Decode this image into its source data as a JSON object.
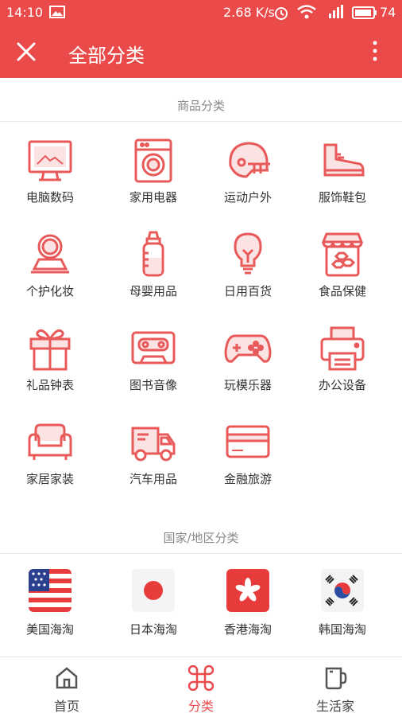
{
  "status_bar": {
    "time": "14:10",
    "speed": "2.68 K/s",
    "battery": "74"
  },
  "app_bar": {
    "title": "全部分类"
  },
  "goods": {
    "section_title": "商品分类",
    "items": [
      {
        "label": "电脑数码",
        "icon": "computer-icon"
      },
      {
        "label": "家用电器",
        "icon": "washing-machine-icon"
      },
      {
        "label": "运动户外",
        "icon": "helmet-icon"
      },
      {
        "label": "服饰鞋包",
        "icon": "shoe-icon"
      },
      {
        "label": "个护化妆",
        "icon": "compact-mirror-icon"
      },
      {
        "label": "母婴用品",
        "icon": "baby-bottle-icon"
      },
      {
        "label": "日用百货",
        "icon": "light-bulb-icon"
      },
      {
        "label": "食品保健",
        "icon": "jar-icon"
      },
      {
        "label": "礼品钟表",
        "icon": "gift-icon"
      },
      {
        "label": "图书音像",
        "icon": "cassette-icon"
      },
      {
        "label": "玩模乐器",
        "icon": "gamepad-icon"
      },
      {
        "label": "办公设备",
        "icon": "printer-icon"
      },
      {
        "label": "家居家装",
        "icon": "sofa-icon"
      },
      {
        "label": "汽车用品",
        "icon": "truck-icon"
      },
      {
        "label": "金融旅游",
        "icon": "bank-card-icon"
      }
    ]
  },
  "countries": {
    "section_title": "国家/地区分类",
    "items": [
      {
        "label": "美国海淘",
        "icon": "us-flag-icon"
      },
      {
        "label": "日本海淘",
        "icon": "japan-flag-icon"
      },
      {
        "label": "香港海淘",
        "icon": "hong-kong-flag-icon"
      },
      {
        "label": "韩国海淘",
        "icon": "korea-flag-icon"
      }
    ]
  },
  "bottom_nav": {
    "items": [
      {
        "label": "首页",
        "icon": "home-icon"
      },
      {
        "label": "分类",
        "icon": "command-icon",
        "active": true
      },
      {
        "label": "生活家",
        "icon": "mug-icon"
      }
    ]
  },
  "colors": {
    "accent": "#ea4a4a",
    "bar_bg": "#ea4a4a",
    "icon_stroke": "#e85a5a"
  }
}
